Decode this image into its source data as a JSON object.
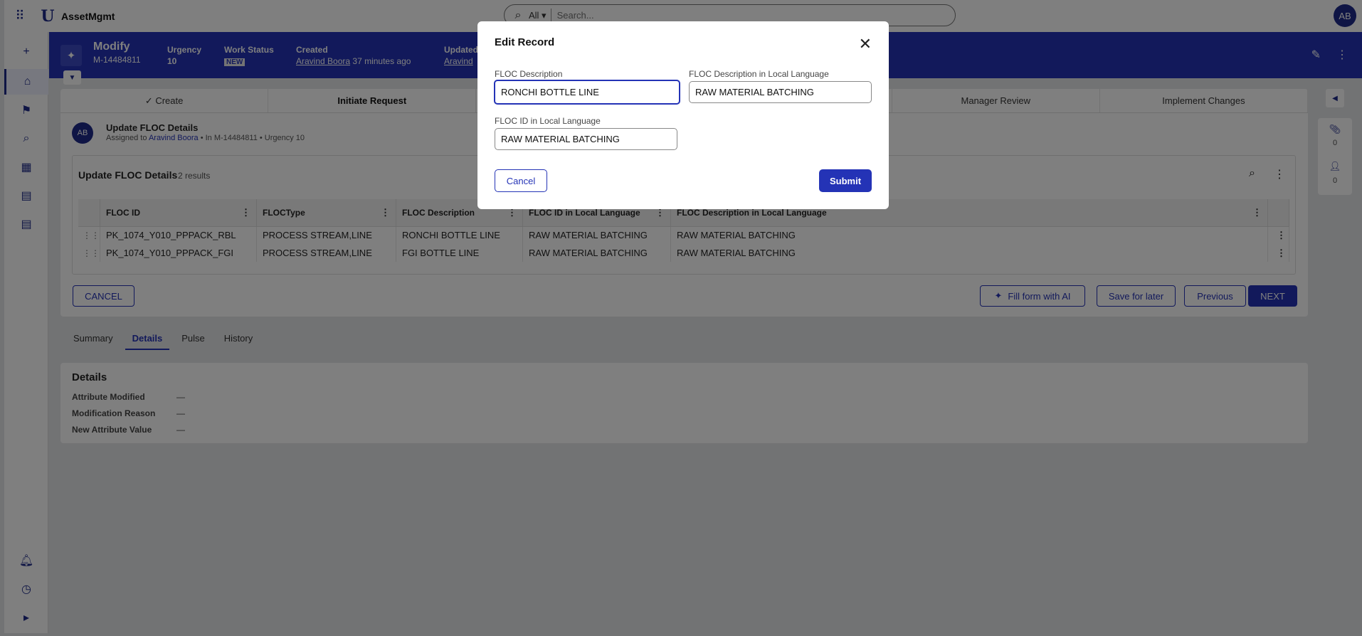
{
  "topbar": {
    "app_name": "AssetMgmt",
    "search_scope": "All ▾",
    "search_placeholder": "Search...",
    "user_initials": "AB"
  },
  "header": {
    "title": "Modify",
    "record_id": "M-14484811",
    "urgency_label": "Urgency",
    "urgency_value": "10",
    "work_status_label": "Work Status",
    "work_status_value": "NEW",
    "created_label": "Created",
    "created_by": "Aravind Boora",
    "created_when": "37 minutes ago",
    "updated_label": "Updated",
    "updated_by": "Aravind"
  },
  "steps": [
    "✓ Create",
    "Initiate Request",
    "",
    "",
    "Manager Review",
    "Implement Changes"
  ],
  "task": {
    "initials": "AB",
    "title": "Update FLOC Details",
    "assigned_prefix": "Assigned to",
    "assignee": "Aravind Boora",
    "meta_suffix": "• In M-14484811 • Urgency 10"
  },
  "grid": {
    "title": "Update FLOC Details",
    "count": "2 results",
    "columns": [
      "FLOC ID",
      "FLOCType",
      "FLOC Description",
      "FLOC ID in Local Language",
      "FLOC Description in Local Language"
    ],
    "rows": [
      [
        "PK_1074_Y010_PPPACK_RBL",
        "PROCESS STREAM,LINE",
        "RONCHI BOTTLE LINE",
        "RAW MATERIAL BATCHING",
        "RAW MATERIAL BATCHING"
      ],
      [
        "PK_1074_Y010_PPPACK_FGI",
        "PROCESS STREAM,LINE",
        "FGI BOTTLE LINE",
        "RAW MATERIAL BATCHING",
        "RAW MATERIAL BATCHING"
      ]
    ]
  },
  "actions": {
    "cancel": "CANCEL",
    "fill_ai": "Fill form with AI",
    "save_later": "Save for later",
    "previous": "Previous",
    "next": "NEXT"
  },
  "tabs": [
    "Summary",
    "Details",
    "Pulse",
    "History"
  ],
  "details": {
    "title": "Details",
    "rows": [
      {
        "label": "Attribute Modified",
        "value": "—"
      },
      {
        "label": "Modification Reason",
        "value": "—"
      },
      {
        "label": "New Attribute Value",
        "value": "—"
      }
    ]
  },
  "rail": {
    "attachments_count": "0",
    "followers_count": "0"
  },
  "modal": {
    "title": "Edit Record",
    "floc_desc_label": "FLOC Description",
    "floc_desc_value": "RONCHI BOTTLE LINE",
    "floc_desc_local_label": "FLOC Description in Local Language",
    "floc_desc_local_value": "RAW MATERIAL BATCHING",
    "floc_id_local_label": "FLOC ID in Local Language",
    "floc_id_local_value": "RAW MATERIAL BATCHING",
    "cancel": "Cancel",
    "submit": "Submit"
  },
  "colors": {
    "brand": "#2433b6",
    "overlay": "rgba(0,0,0,0.5)"
  }
}
